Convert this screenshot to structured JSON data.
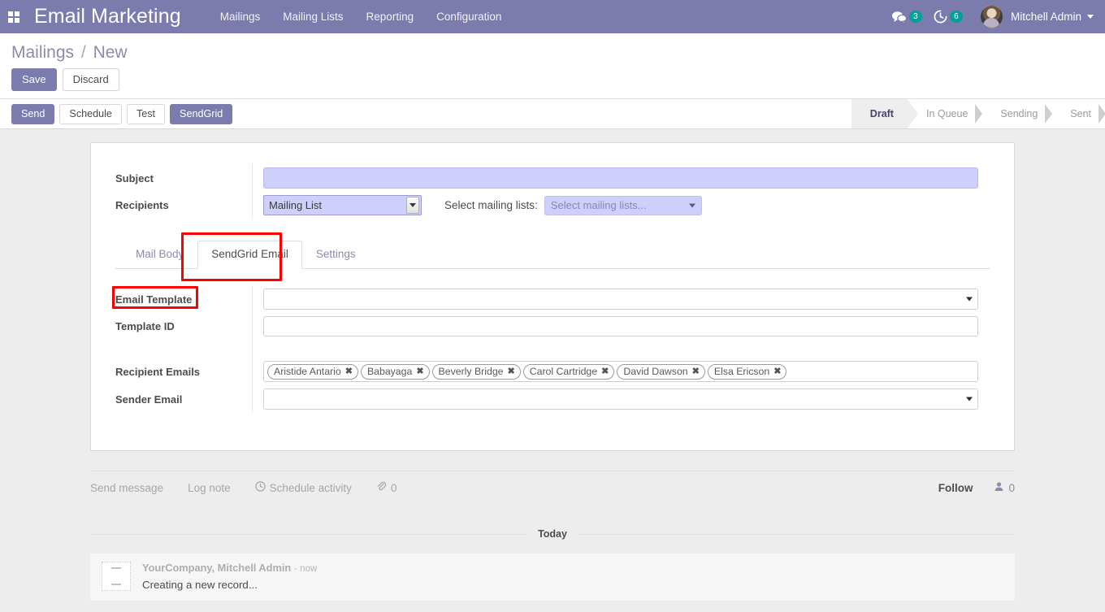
{
  "navbar": {
    "apps_icon": "apps-grid-icon",
    "brand": "Email Marketing",
    "menu": [
      "Mailings",
      "Mailing Lists",
      "Reporting",
      "Configuration"
    ],
    "messages_icon": "chat-bubble-icon",
    "messages_count": "3",
    "activities_icon": "clock-icon",
    "activities_count": "6",
    "user_name": "Mitchell Admin",
    "accent_color": "#7c7bad",
    "badge_color": "#00a09d"
  },
  "breadcrumb": {
    "parent": "Mailings",
    "separator": "/",
    "current": "New"
  },
  "actions": {
    "save": "Save",
    "discard": "Discard"
  },
  "statusbar_buttons": {
    "send": "Send",
    "schedule": "Schedule",
    "test": "Test",
    "sendgrid": "SendGrid"
  },
  "statusbar": {
    "stages": [
      "Draft",
      "In Queue",
      "Sending",
      "Sent"
    ],
    "active": "Draft"
  },
  "form": {
    "subject": {
      "label": "Subject",
      "value": "",
      "required": true
    },
    "recipients": {
      "label": "Recipients",
      "value": "Mailing List",
      "required": true
    },
    "mailing_lists": {
      "inline_label": "Select mailing lists:",
      "placeholder": "Select mailing lists...",
      "value": ""
    }
  },
  "tabs": [
    {
      "label": "Mail Body",
      "active": false
    },
    {
      "label": "SendGrid Email",
      "active": true
    },
    {
      "label": "Settings",
      "active": false
    }
  ],
  "sendgrid_tab": {
    "email_template": {
      "label": "Email Template",
      "value": ""
    },
    "template_id": {
      "label": "Template ID",
      "value": ""
    },
    "recipient_emails": {
      "label": "Recipient Emails",
      "tags": [
        "Aristide Antario",
        "Babayaga",
        "Beverly Bridge",
        "Carol Cartridge",
        "David Dawson",
        "Elsa Ericson"
      ],
      "remove_icon": "close-x-icon"
    },
    "sender_email": {
      "label": "Sender Email",
      "value": ""
    }
  },
  "annotations": {
    "color": "#ff0000",
    "boxes": [
      "sendgrid-email-tab",
      "email-template-label"
    ]
  },
  "chatter": {
    "send_message": "Send message",
    "log_note": "Log note",
    "schedule_activity": "Schedule activity",
    "schedule_icon": "clock-icon",
    "attachment_icon": "paperclip-icon",
    "attachment_count": "0",
    "follow": "Follow",
    "followers_icon": "user-icon",
    "followers_count": "0",
    "day_separator": "Today",
    "messages": [
      {
        "author": "YourCompany, Mitchell Admin",
        "time_separator": "-",
        "time": "now",
        "body": "Creating a new record..."
      }
    ]
  }
}
